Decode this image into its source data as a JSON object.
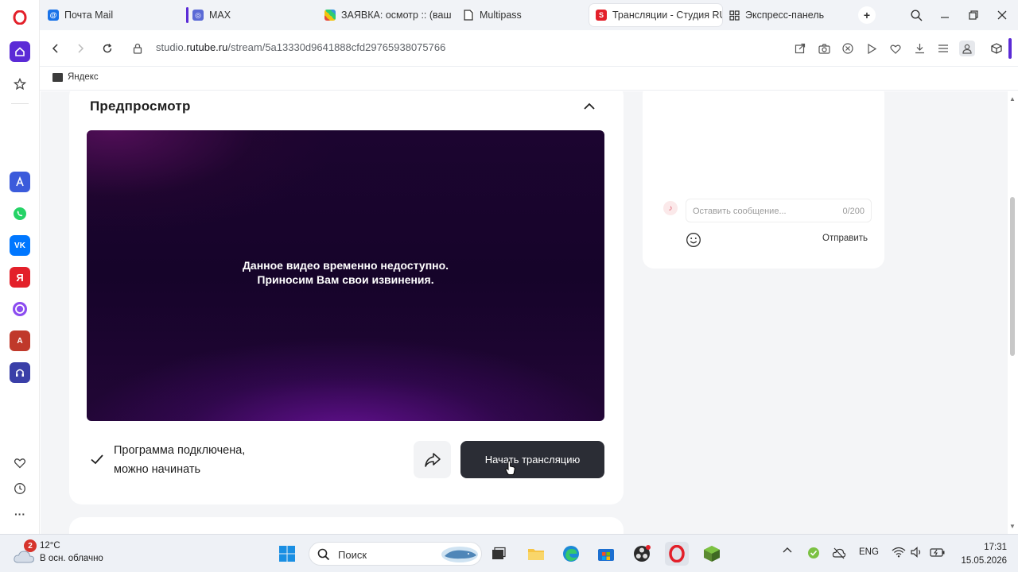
{
  "tabs": [
    {
      "label": "Почта Mail"
    },
    {
      "label": "MAX"
    },
    {
      "label": "ЗАЯВКА: осмотр :: (ваш l"
    },
    {
      "label": "Multipass"
    },
    {
      "label": "Трансляции - Студия RU"
    },
    {
      "label": "Экспресс-панель"
    }
  ],
  "address": {
    "prefix": "studio.",
    "domain": "rutube.ru",
    "path": "/stream/5a13330d9641888cfd29765938075766"
  },
  "bookmarks": [
    {
      "label": "Яндекс"
    }
  ],
  "preview": {
    "title": "Предпросмотр",
    "message_line1": "Данное видео временно недоступно.",
    "message_line2": "Приносим Вам свои извинения.",
    "status_line1": "Программа подключена,",
    "status_line2": "можно начинать",
    "start_button": "Начать трансляцию"
  },
  "chat": {
    "placeholder": "Оставить сообщение...",
    "counter": "0/200",
    "send_label": "Отправить"
  },
  "taskbar": {
    "weather_badge": "2",
    "temperature": "12°C",
    "condition": "В осн. облачно",
    "search_label": "Поиск",
    "language": "ENG",
    "time": "17:31",
    "date": "15.05.2026"
  },
  "colors": {
    "accent": "#5b2bd6",
    "opera_red": "#e3202a",
    "start_button_bg": "#2b2d35"
  }
}
